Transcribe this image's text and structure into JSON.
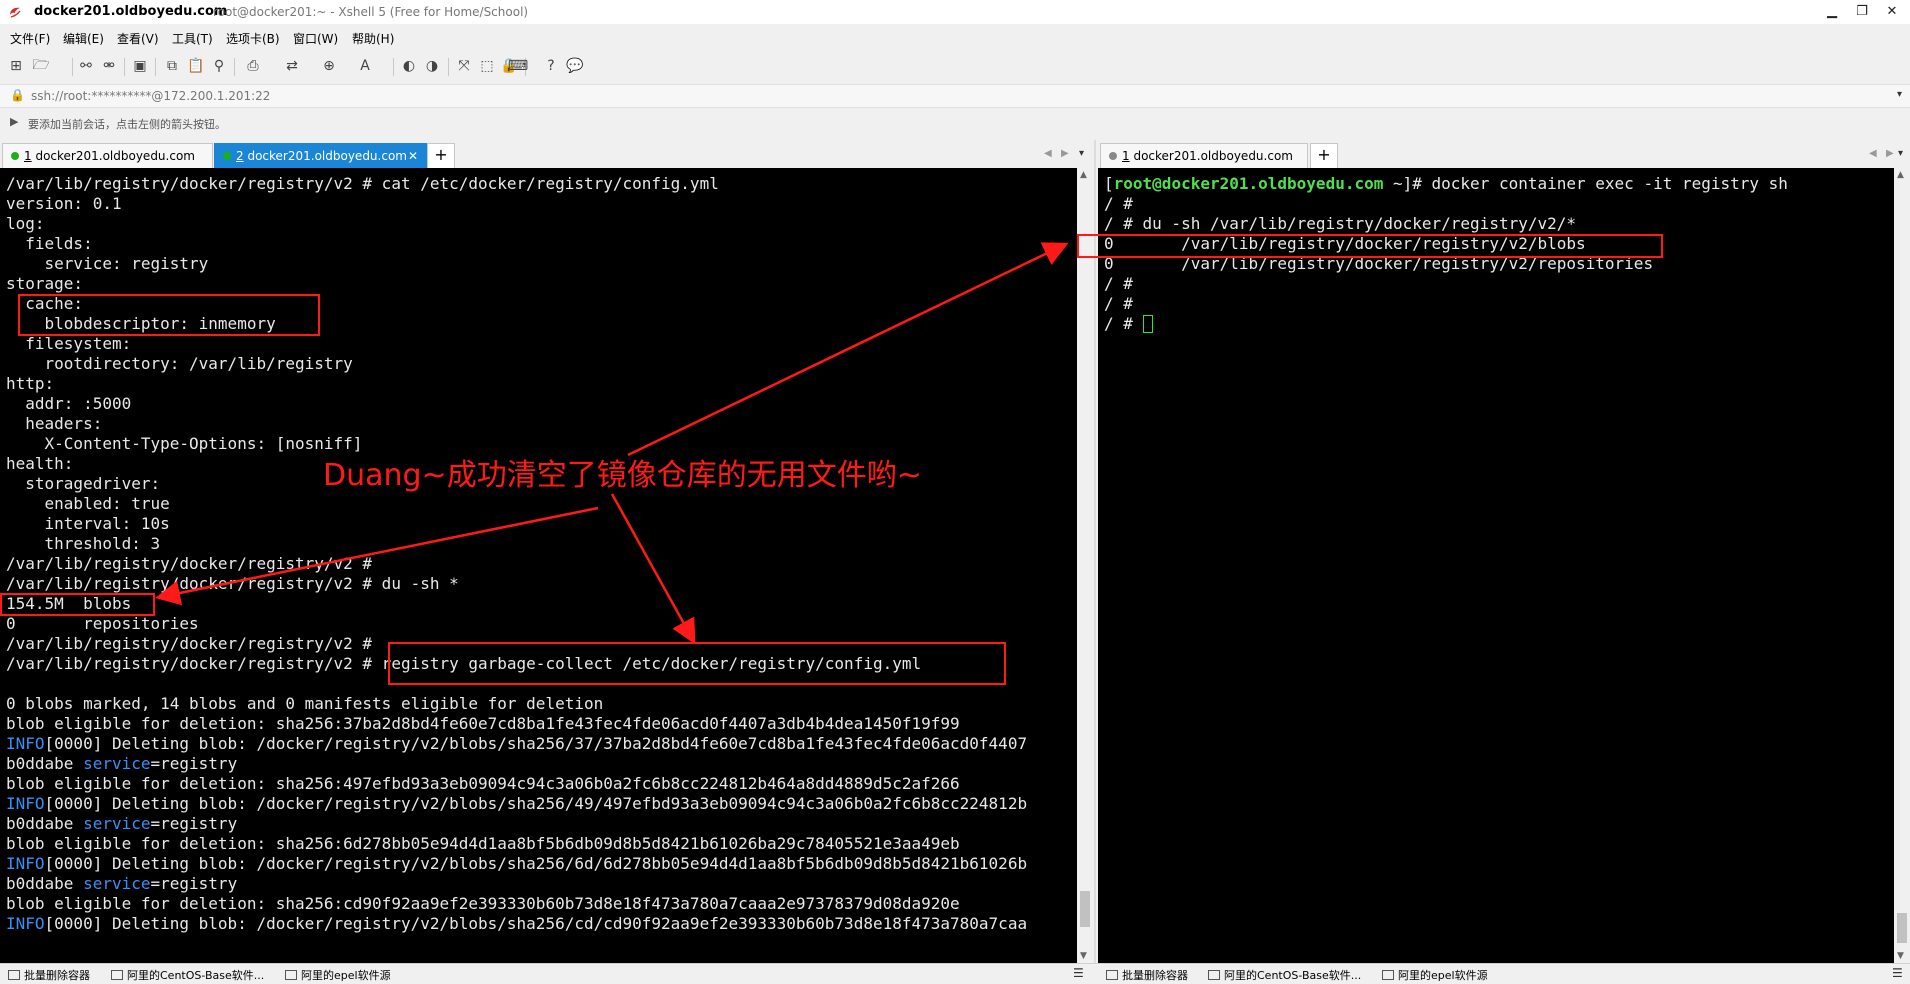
{
  "titlebar": {
    "title": "docker201.oldboyedu.com",
    "subtitle": "root@docker201:~ - Xshell 5 (Free for Home/School)",
    "minimize": "▁",
    "restore": "❐",
    "close": "✕"
  },
  "menu": [
    "文件(F)",
    "编辑(E)",
    "查看(V)",
    "工具(T)",
    "选项卡(B)",
    "窗口(W)",
    "帮助(H)"
  ],
  "address": "ssh://root:**********@172.200.1.201:22",
  "hint": "要添加当前会话，点击左侧的箭头按钮。",
  "left_tabs": [
    {
      "num": "1",
      "label": "docker201.oldboyedu.com",
      "active": false
    },
    {
      "num": "2",
      "label": "docker201.oldboyedu.com",
      "active": true
    }
  ],
  "right_tabs": [
    {
      "num": "1",
      "label": "docker201.oldboyedu.com",
      "active": false
    }
  ],
  "left_terminal": [
    "/var/lib/registry/docker/registry/v2 # cat /etc/docker/registry/config.yml",
    "version: 0.1",
    "log:",
    "  fields:",
    "    service: registry",
    "storage:",
    "  cache:",
    "    blobdescriptor: inmemory",
    "  filesystem:",
    "    rootdirectory: /var/lib/registry",
    "http:",
    "  addr: :5000",
    "  headers:",
    "    X-Content-Type-Options: [nosniff]",
    "health:",
    "  storagedriver:",
    "    enabled: true",
    "    interval: 10s",
    "    threshold: 3",
    "/var/lib/registry/docker/registry/v2 #",
    "/var/lib/registry/docker/registry/v2 # du -sh *",
    "154.5M  blobs",
    "0       repositories",
    "/var/lib/registry/docker/registry/v2 #",
    "/var/lib/registry/docker/registry/v2 # registry garbage-collect /etc/docker/registry/config.yml",
    "",
    "0 blobs marked, 14 blobs and 0 manifests eligible for deletion",
    "blob eligible for deletion: sha256:37ba2d8bd4fe60e7cd8ba1fe43fec4fde06acd0f4407a3db4b4dea1450f19f99",
    "INFO|[0000] Deleting blob: /docker/registry/v2/blobs/sha256/37/37ba2d8bd4fe60e7cd8ba1fe43fec4fde06acd0f4407",
    "b0ddabe |service|=registry",
    "blob eligible for deletion: sha256:497efbd93a3eb09094c94c3a06b0a2fc6b8cc224812b464a8dd4889d5c2af266",
    "INFO|[0000] Deleting blob: /docker/registry/v2/blobs/sha256/49/497efbd93a3eb09094c94c3a06b0a2fc6b8cc224812b",
    "b0ddabe |service|=registry",
    "blob eligible for deletion: sha256:6d278bb05e94d4d1aa8bf5b6db09d8b5d8421b61026ba29c78405521e3aa49eb",
    "INFO|[0000] Deleting blob: /docker/registry/v2/blobs/sha256/6d/6d278bb05e94d4d1aa8bf5b6db09d8b5d8421b61026b",
    "b0ddabe |service|=registry",
    "blob eligible for deletion: sha256:cd90f92aa9ef2e393330b60b73d8e18f473a780a7caaa2e97378379d08da920e",
    "INFO|[0000] Deleting blob: /docker/registry/v2/blobs/sha256/cd/cd90f92aa9ef2e393330b60b73d8e18f473a780a7caa"
  ],
  "right_terminal": {
    "first_line": {
      "open": "[",
      "user_host": "root@docker201.oldboyedu.com",
      "rest": " ~]# docker container exec -it registry sh"
    },
    "lines": [
      "/ #",
      "/ # du -sh /var/lib/registry/docker/registry/v2/*",
      "0       /var/lib/registry/docker/registry/v2/blobs",
      "0       /var/lib/registry/docker/registry/v2/repositories",
      "/ #",
      "/ #",
      "/ # "
    ]
  },
  "annotation": "Duang~成功清空了镜像仓库的无用文件哟~",
  "statusbar_left": [
    "批量删除容器",
    "阿里的CentOS-Base软件...",
    "阿里的epel软件源"
  ],
  "statusbar_right": [
    "批量删除容器",
    "阿里的CentOS-Base软件...",
    "阿里的epel软件源"
  ],
  "colors": {
    "terminal_bg": "#000000",
    "terminal_fg": "#e8e8e8",
    "info_blue": "#3a8ff5",
    "prompt_green": "#4ee04e",
    "annotation_red": "#ff1a1a",
    "active_tab": "#1b86d6"
  }
}
